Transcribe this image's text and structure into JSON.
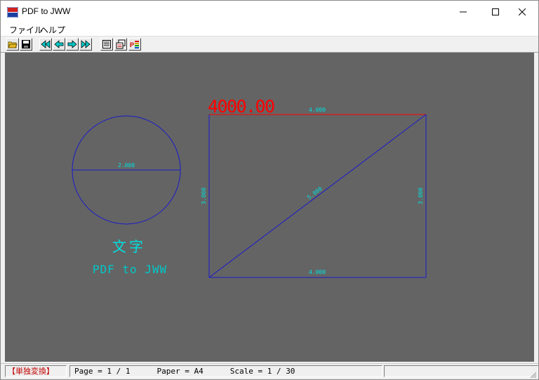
{
  "window": {
    "title": "PDF to JWW",
    "app_icon_text": "PDF JWW"
  },
  "menu": [
    {
      "label": "ファイル"
    },
    {
      "label": "ヘルプ"
    }
  ],
  "toolbar": {
    "buttons": [
      {
        "name": "open-icon"
      },
      {
        "name": "save-icon"
      },
      {
        "name": "first-page-icon"
      },
      {
        "name": "prev-page-icon"
      },
      {
        "name": "next-page-icon"
      },
      {
        "name": "last-page-icon"
      },
      {
        "name": "list-icon"
      },
      {
        "name": "layers-icon"
      },
      {
        "name": "pdf-settings-icon"
      }
    ]
  },
  "drawing": {
    "circle_dimension": "2.000",
    "text_kanji": "文字",
    "text_label": "PDF to JWW",
    "rect_top_dimension": "4.000",
    "rect_bottom_dimension": "4.000",
    "rect_left_dimension": "3.000",
    "rect_right_dimension": "3.000",
    "diagonal_dimension": "5.000",
    "big_value": "4000.00",
    "colors": {
      "background": "#646464",
      "lines": "#1a1acc",
      "dimension_text": "#00e0e0",
      "highlight": "#ff0000"
    }
  },
  "status": {
    "mode": "【単独変換】",
    "page": "Page = 1 / 1",
    "paper": "Paper = A4",
    "scale": "Scale = 1 / 30"
  }
}
